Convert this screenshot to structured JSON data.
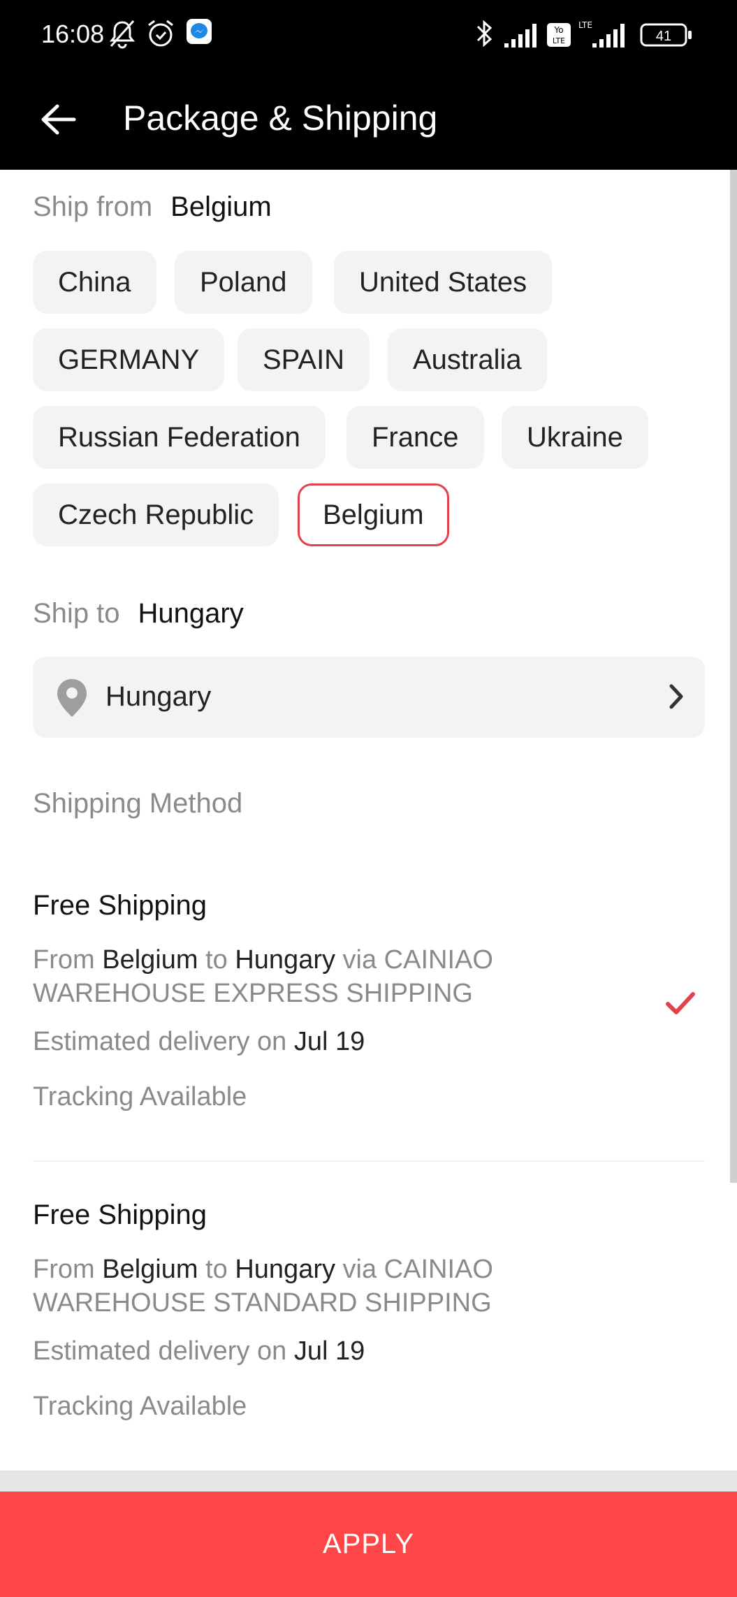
{
  "status_bar": {
    "time": "16:08",
    "battery": "41",
    "icons": [
      "notifications-off-icon",
      "alarm-icon",
      "messenger-icon",
      "bluetooth-icon",
      "signal-icon",
      "volte-icon",
      "lte-signal-icon",
      "battery-icon"
    ]
  },
  "app_bar": {
    "title": "Package & Shipping",
    "back_icon": "arrow-left-icon"
  },
  "ship_from": {
    "label": "Ship from",
    "selected": "Belgium",
    "options": [
      "China",
      "Poland",
      "United States",
      "GERMANY",
      "SPAIN",
      "Australia",
      "Russian Federation",
      "France",
      "Ukraine",
      "Czech Republic",
      "Belgium"
    ]
  },
  "ship_to": {
    "label": "Ship to",
    "selected": "Hungary",
    "field_value": "Hungary",
    "pin_icon": "location-pin-icon",
    "chevron_icon": "chevron-right-icon"
  },
  "shipping_method": {
    "label": "Shipping Method",
    "methods": [
      {
        "title": "Free Shipping",
        "from_word": "From",
        "from": "Belgium",
        "to_word": "to",
        "to": "Hungary",
        "via_text": "via CAINIAO WAREHOUSE EXPRESS SHIPPING",
        "est_label": "Estimated delivery on",
        "est_date": "Jul 19",
        "tracking": "Tracking Available",
        "selected": true
      },
      {
        "title": "Free Shipping",
        "from_word": "From",
        "from": "Belgium",
        "to_word": "to",
        "to": "Hungary",
        "via_text": "via CAINIAO WAREHOUSE STANDARD SHIPPING",
        "est_label": "Estimated delivery on",
        "est_date": "Jul 19",
        "tracking": "Tracking Available",
        "selected": false
      }
    ]
  },
  "apply_label": "APPLY",
  "colors": {
    "accent": "#ff4747",
    "selected_border": "#e4424a",
    "chip_bg": "#f3f3f3",
    "muted_text": "#8a8a8a"
  }
}
